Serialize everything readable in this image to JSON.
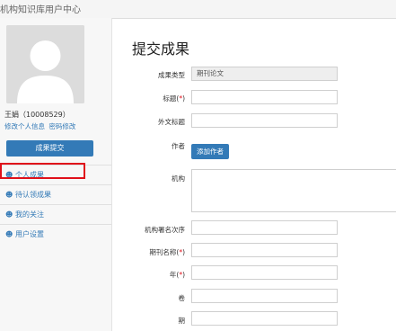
{
  "app": {
    "title": "机构知识库用户中心"
  },
  "user": {
    "name_id": "王娟（10008529）",
    "links": [
      "修改个人信息",
      "密码修改"
    ],
    "submit_button": "成果提交"
  },
  "nav": {
    "items": [
      {
        "label": "个人成果",
        "icon": "person-icon"
      },
      {
        "label": "待认领成果",
        "icon": "person-icon"
      },
      {
        "label": "我的关注",
        "icon": "person-icon"
      },
      {
        "label": "用户设置",
        "icon": "person-icon"
      }
    ]
  },
  "form": {
    "title": "提交成果",
    "fields": {
      "type_label": "成果类型",
      "type_value": "期刊论文",
      "title_label": "标题(",
      "title_req": "*",
      "title_close": ")",
      "foreign_title_label": "外文标题",
      "author_label": "作者",
      "add_author": "添加作者",
      "org_label": "机构",
      "org_order_label": "机构署名次序",
      "journal_label": "期刊名称(",
      "journal_req": "*",
      "journal_close": ")",
      "year_label": "年(",
      "year_req": "*",
      "year_close": ")",
      "volume_label": "卷",
      "issue_label": "期"
    }
  },
  "colors": {
    "accent": "#337ab7",
    "highlight": "#e0101a",
    "required": "#e0101a"
  }
}
